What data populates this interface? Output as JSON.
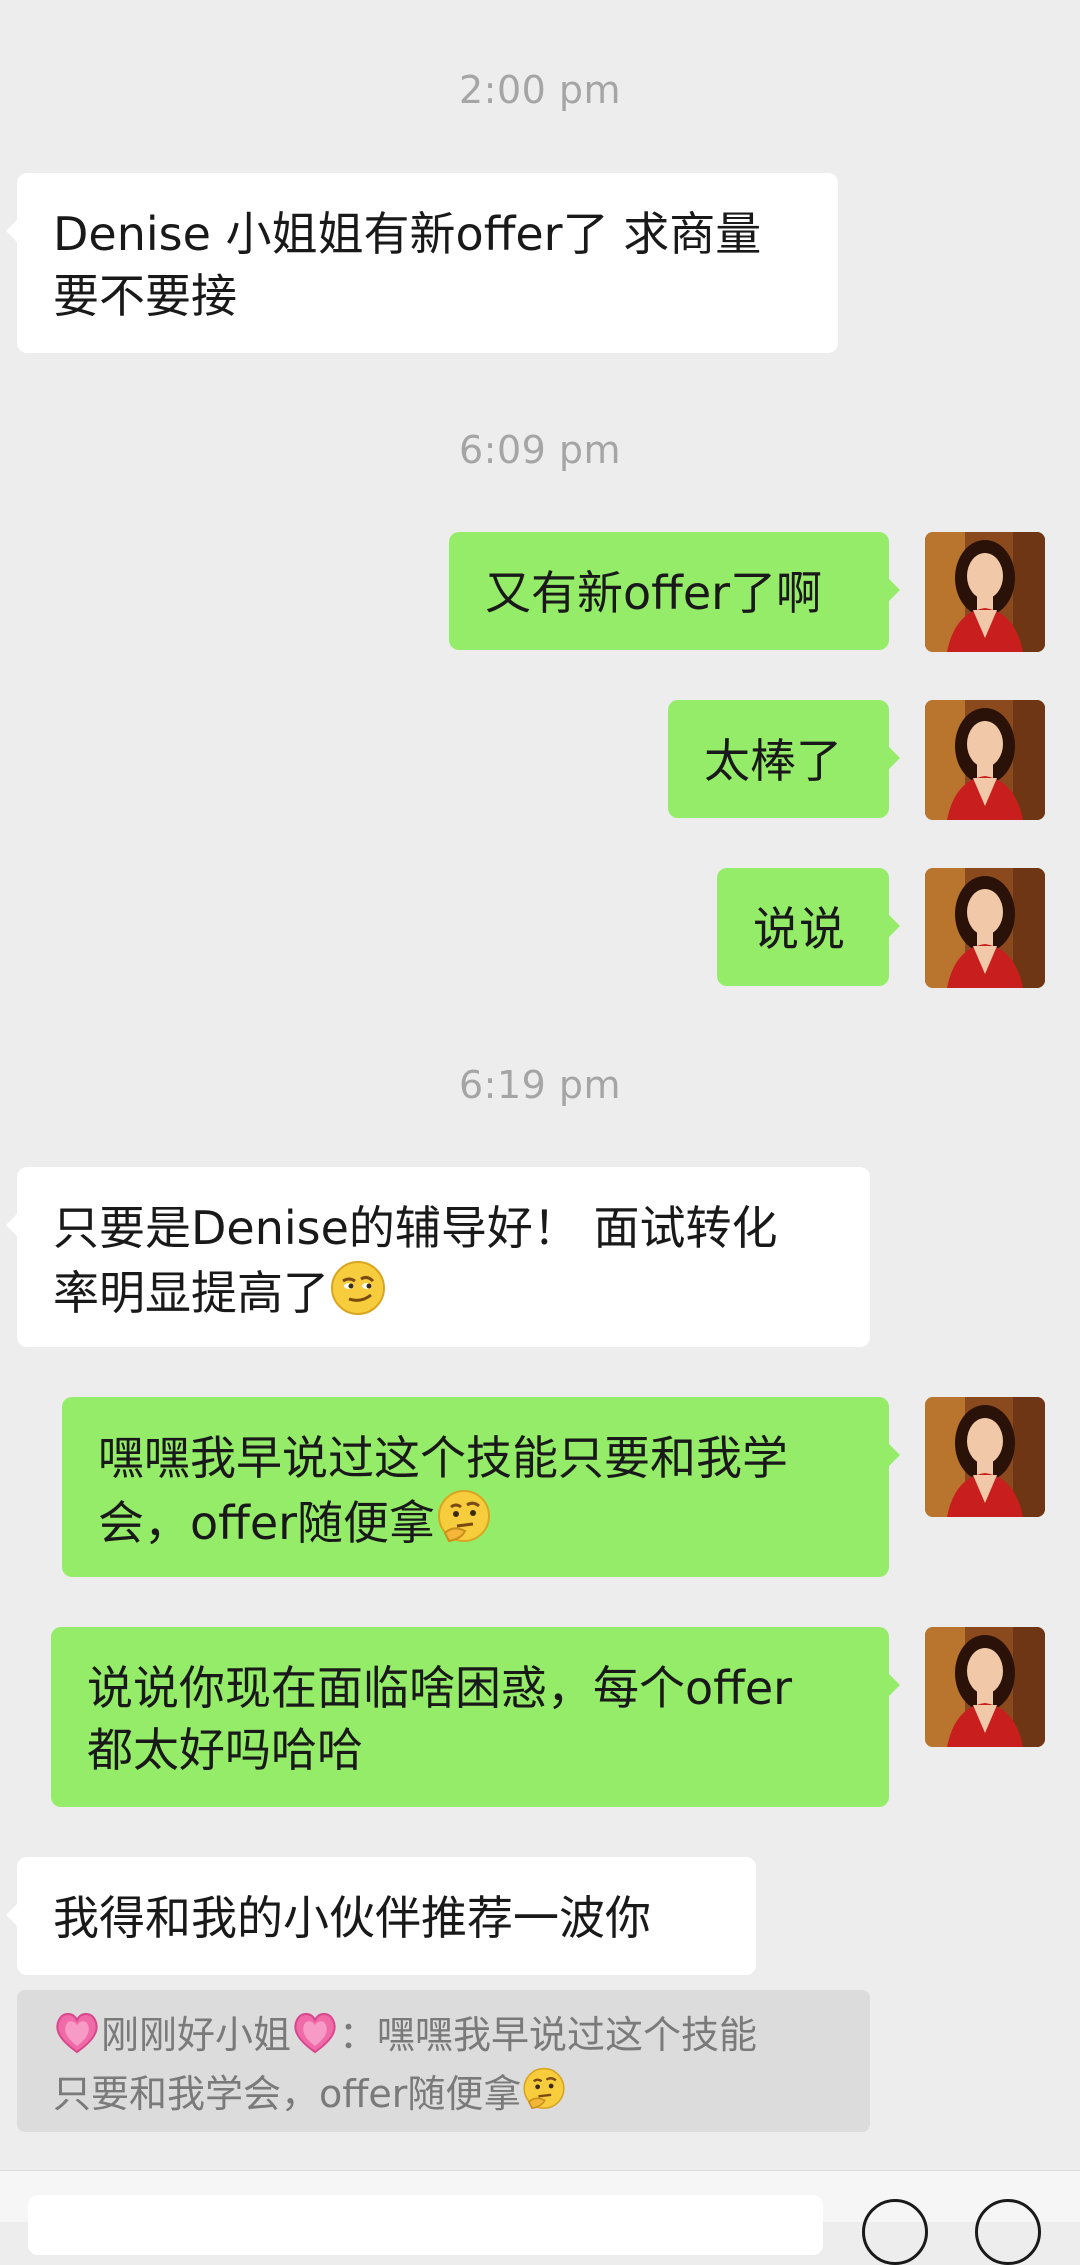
{
  "timestamps": [
    "2:00 pm",
    "6:09 pm",
    "6:19 pm"
  ],
  "messages": {
    "m1": "Denise 小姐姐有新offer了 求商量\n要不要接",
    "m2": "又有新offer了啊",
    "m3": "太棒了",
    "m4": "说说",
    "m5": "只要是Denise的辅导好！ 面试转化\n率明显提高了",
    "m6": "嘿嘿我早说过这个技能只要和我学\n会，offer随便拿",
    "m7": "说说你现在面临啥困惑，每个offer\n都太好吗哈哈",
    "m8": "我得和我的小伙伴推荐一波你"
  },
  "quote": {
    "sender": "刚刚好小姐",
    "separator": "：",
    "text_line1": "嘿嘿我早说过这个技能",
    "text_line2": "只要和我学会，offer随便拿"
  },
  "icons": {
    "emoji_smirk": "smirking-face-icon",
    "emoji_thinking": "thinking-face-icon",
    "emoji_heart": "pink-heart-icon",
    "avatar": "user-avatar"
  },
  "colors": {
    "background": "#ededed",
    "incoming_bubble": "#ffffff",
    "outgoing_bubble": "#95ec69",
    "timestamp": "#a5a5a5"
  }
}
